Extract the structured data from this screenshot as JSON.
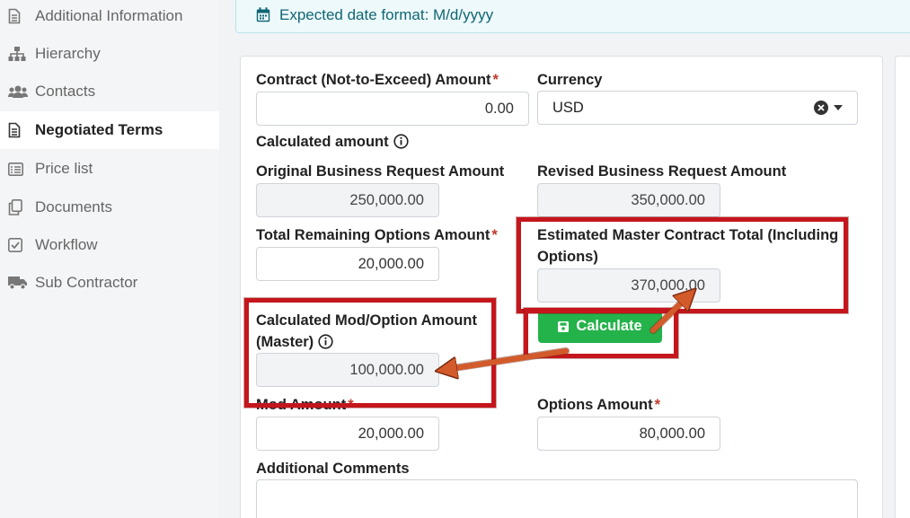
{
  "sidebar": {
    "items": [
      {
        "label": "Additional Information",
        "icon": "document-icon",
        "active": false
      },
      {
        "label": "Hierarchy",
        "icon": "hierarchy-icon",
        "active": false
      },
      {
        "label": "Contacts",
        "icon": "users-icon",
        "active": false
      },
      {
        "label": "Negotiated Terms",
        "icon": "document-icon",
        "active": true
      },
      {
        "label": "Price list",
        "icon": "list-icon",
        "active": false
      },
      {
        "label": "Documents",
        "icon": "copy-icon",
        "active": false
      },
      {
        "label": "Workflow",
        "icon": "checkbox-icon",
        "active": false
      },
      {
        "label": "Sub Contractor",
        "icon": "truck-icon",
        "active": false
      }
    ]
  },
  "banner": {
    "text": "Expected date format: M/d/yyyy",
    "icon": "calendar-icon"
  },
  "form": {
    "contract_amount": {
      "label": "Contract (Not-to-Exceed) Amount",
      "value": "0.00",
      "required": "*"
    },
    "currency": {
      "label": "Currency",
      "value": "USD"
    },
    "calculated_amount": {
      "label": "Calculated amount"
    },
    "original_request": {
      "label": "Original Business Request Amount",
      "value": "250,000.00"
    },
    "revised_request": {
      "label": "Revised Business Request Amount",
      "value": "350,000.00"
    },
    "total_remaining_options": {
      "label": "Total Remaining Options Amount",
      "value": "20,000.00",
      "required": "*"
    },
    "estimated_master_total": {
      "label_line1": "Estimated Master Contract Total (Including",
      "label_line2": "Options)",
      "value": "370,000.00"
    },
    "calculated_mod_option": {
      "label_line1": "Calculated Mod/Option Amount",
      "label_line2": "(Master)",
      "value": "100,000.00"
    },
    "calculate_button": {
      "label": "Calculate"
    },
    "mod_amount": {
      "label": "Mod Amount",
      "value": "20,000.00",
      "required": "*"
    },
    "options_amount": {
      "label": "Options Amount",
      "value": "80,000.00",
      "required": "*"
    },
    "additional_comments": {
      "label": "Additional Comments"
    }
  },
  "colors": {
    "annotation": "#c4161c",
    "arrow": "#d35a2a",
    "calculate_button": "#24b24a",
    "required": "#c0392b"
  }
}
